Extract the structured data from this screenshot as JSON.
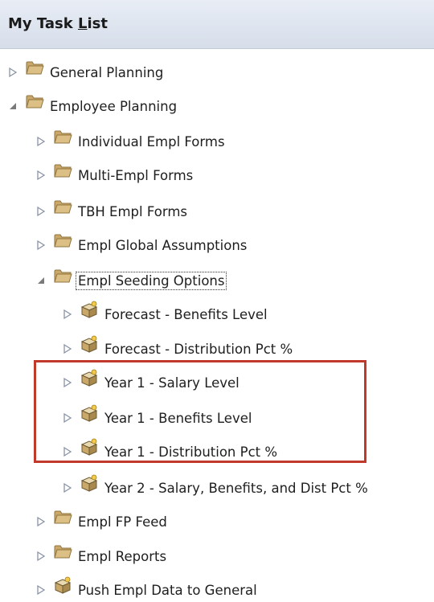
{
  "header": {
    "title_prefix": "My Task ",
    "title_underlined": "L",
    "title_suffix": "ist"
  },
  "tree": [
    {
      "label": "General Planning",
      "icon": "folder-icon",
      "state": "collapsed"
    },
    {
      "label": "Employee Planning",
      "icon": "folder-icon",
      "state": "expanded"
    },
    {
      "label": "Individual Empl Forms",
      "icon": "folder-icon",
      "state": "collapsed"
    },
    {
      "label": "Multi-Empl Forms",
      "icon": "folder-icon",
      "state": "collapsed"
    },
    {
      "label": "TBH Empl Forms",
      "icon": "folder-icon",
      "state": "collapsed"
    },
    {
      "label": "Empl Global Assumptions",
      "icon": "folder-icon",
      "state": "collapsed"
    },
    {
      "label": "Empl Seeding Options",
      "icon": "folder-icon",
      "state": "expanded"
    },
    {
      "label": "Forecast - Benefits Level",
      "icon": "task-box-icon",
      "state": "collapsed"
    },
    {
      "label": "Forecast - Distribution Pct %",
      "icon": "task-box-icon",
      "state": "collapsed"
    },
    {
      "label": "Year 1 - Salary Level",
      "icon": "task-box-icon",
      "state": "collapsed"
    },
    {
      "label": "Year 1 - Benefits Level",
      "icon": "task-box-icon",
      "state": "collapsed"
    },
    {
      "label": "Year 1 - Distribution Pct %",
      "icon": "task-box-icon",
      "state": "collapsed"
    },
    {
      "label": "Year 2 - Salary, Benefits, and Dist Pct %",
      "icon": "task-box-icon",
      "state": "collapsed"
    },
    {
      "label": "Empl FP Feed",
      "icon": "folder-icon",
      "state": "collapsed"
    },
    {
      "label": "Empl Reports",
      "icon": "folder-icon",
      "state": "collapsed"
    },
    {
      "label": "Push Empl Data to General",
      "icon": "task-box-icon",
      "state": "collapsed"
    }
  ],
  "colors": {
    "highlight_border": "#c0392b",
    "folder": "#c9a86a",
    "header_bg": "#dfe5ee"
  }
}
